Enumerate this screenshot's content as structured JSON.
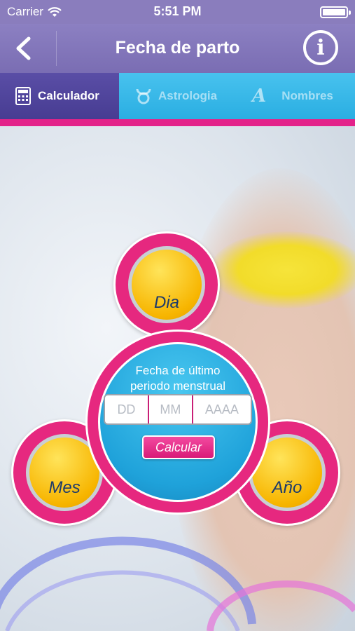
{
  "status_bar": {
    "carrier": "Carrier",
    "time": "5:51 PM"
  },
  "nav": {
    "title": "Fecha de parto",
    "back_icon": "chevron-left-icon",
    "info_icon": "info-icon"
  },
  "tabs": [
    {
      "label": "Calculador",
      "icon": "calculator-icon",
      "active": true
    },
    {
      "label": "Astrologia",
      "icon": "taurus-icon",
      "active": false
    },
    {
      "label": "Nombres",
      "icon": "letter-a-icon",
      "active": false
    }
  ],
  "calculator": {
    "day_label": "Dia",
    "month_label": "Mes",
    "year_label": "Año",
    "form_title_line1": "Fecha de último",
    "form_title_line2": "periodo menstrual",
    "day_placeholder": "DD",
    "month_placeholder": "MM",
    "year_placeholder": "AAAA",
    "calculate_label": "Calcular"
  },
  "colors": {
    "nav": "#7a6db3",
    "tab_active": "#473c92",
    "tab_bar": "#2aaee2",
    "accent_pink": "#e3238a",
    "yellow": "#f7b500"
  }
}
